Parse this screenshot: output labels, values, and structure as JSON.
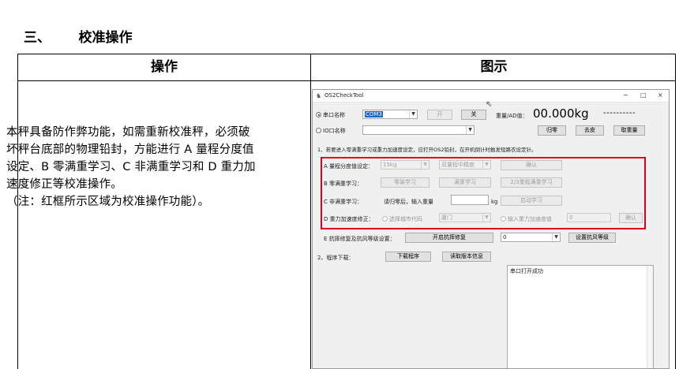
{
  "section": {
    "number": "三、",
    "title": "校准操作"
  },
  "table": {
    "col_operation": "操作",
    "col_illustration": "图示",
    "desc_lines": [
      "本秤具备防作弊功能，如需重新校准秤，必须破",
      "坏秤台底部的物理铅封，方能进行 A 量程分度值",
      "设定、B 零满重学习、C 非满重学习和 D 重力加",
      "速度修正等校准操作。",
      "（注：红框所示区域为校准操作功能）。"
    ]
  },
  "app": {
    "title": "OS2CheckTool",
    "window_controls": {
      "minimize": "−",
      "maximize": "□",
      "close": "×"
    },
    "serial_port_label": "串口名称",
    "serial_port_value": "COM3",
    "open_button": "开",
    "close_button": "关",
    "weight_ad_label": "重量/AD值：",
    "weight_value": "00.000kg",
    "ad_value": "----------",
    "io_port_label": "IO口名称",
    "io_port_value": "",
    "zero_button": "归零",
    "tare_button": "去皮",
    "fetch_weight_button": "取重量",
    "step1_text": "1、若要进入零满重学习或重力加速度设定，应打开OS2铅封，在开机倒计时触发短路衣设定针。",
    "range": {
      "label": "A 量程分度值设定：",
      "range_value": "15kg",
      "precision_value": "双量程中精度",
      "confirm_button": "确认"
    },
    "zero_full": {
      "label": "B 零满重学习：",
      "zero_button": "零装学习",
      "full_button": "满重学习",
      "dual_button": "2/3重程满重学习"
    },
    "nonfull": {
      "label": "C 非满重学习：",
      "hint": "请归零后，输入重量",
      "unit": "kg",
      "start_button": "启动学习"
    },
    "gravity": {
      "label": "D 重力加速度修正：",
      "option_region": "选择城市代码",
      "region_value": "厦门",
      "option_input": "输入重力加速度值",
      "input_value": "0",
      "confirm_button": "确认"
    },
    "tamper": {
      "label": "E 抗摔修复及抗风等级设置：",
      "button": "开启抗摔修复",
      "level_value": "0",
      "set_button": "设置抗风等级"
    },
    "download": {
      "label": "2、程序下载：",
      "download_button": "下载程序",
      "read_version_button": "读取版本信息"
    },
    "log_text": "串口打开成功"
  },
  "colors": {
    "highlight_box": "#e0001b",
    "selection": "#1e64c8"
  },
  "icons": {
    "app": "app-icon",
    "cursor": "cursor-icon"
  }
}
